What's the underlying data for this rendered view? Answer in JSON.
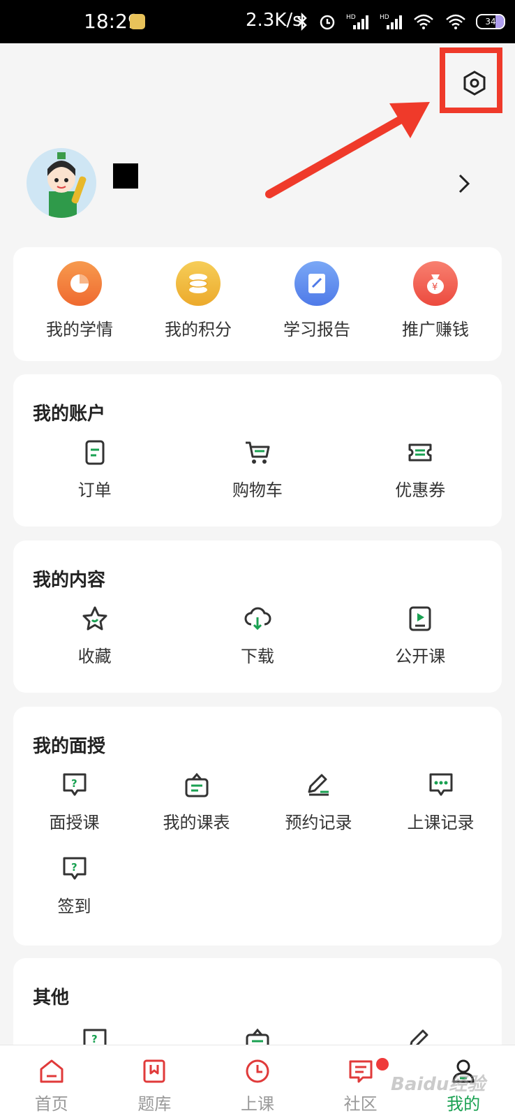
{
  "status_bar": {
    "time": "18:29",
    "network_speed": "2.3K/s",
    "battery": "34"
  },
  "colors": {
    "accent_green": "#1aa152",
    "tab_red": "#e03a3a",
    "highlight_red": "#ef3a2a"
  },
  "quick_actions": [
    {
      "label": "我的学情",
      "icon": "pie-chart-icon",
      "color": "#f27a3a"
    },
    {
      "label": "我的积分",
      "icon": "coins-icon",
      "color": "#f1b93a"
    },
    {
      "label": "学习报告",
      "icon": "report-icon",
      "color": "#5c8df0"
    },
    {
      "label": "推广赚钱",
      "icon": "money-bag-icon",
      "color": "#f0584a"
    }
  ],
  "account": {
    "title": "我的账户",
    "items": [
      {
        "label": "订单",
        "icon": "order-icon"
      },
      {
        "label": "购物车",
        "icon": "cart-icon"
      },
      {
        "label": "优惠券",
        "icon": "coupon-icon"
      }
    ]
  },
  "content": {
    "title": "我的内容",
    "items": [
      {
        "label": "收藏",
        "icon": "star-icon"
      },
      {
        "label": "下载",
        "icon": "cloud-download-icon"
      },
      {
        "label": "公开课",
        "icon": "play-doc-icon"
      }
    ]
  },
  "face_to_face": {
    "title": "我的面授",
    "items": [
      {
        "label": "面授课",
        "icon": "question-bubble-icon"
      },
      {
        "label": "我的课表",
        "icon": "schedule-bag-icon"
      },
      {
        "label": "预约记录",
        "icon": "edit-pen-icon"
      },
      {
        "label": "上课记录",
        "icon": "chat-dots-icon"
      },
      {
        "label": "签到",
        "icon": "question-bubble-icon"
      }
    ]
  },
  "other": {
    "title": "其他"
  },
  "tabs": [
    {
      "label": "首页",
      "icon": "home-icon"
    },
    {
      "label": "题库",
      "icon": "bookmark-icon"
    },
    {
      "label": "上课",
      "icon": "clock-icon"
    },
    {
      "label": "社区",
      "icon": "message-icon"
    },
    {
      "label": "我的",
      "icon": "user-icon"
    }
  ],
  "watermark": "Baidu经验"
}
